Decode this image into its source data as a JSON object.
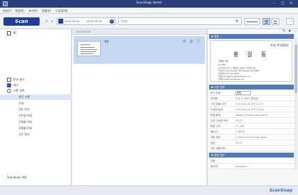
{
  "window": {
    "title": "ScanSnap Home",
    "minimize": "–",
    "maximize": "□",
    "close": "✕"
  },
  "menu": [
    "파일(F)",
    "편집(E)",
    "표시(V)",
    "정렬(S)",
    "도움말(H)"
  ],
  "toolbar": {
    "scan_label": "Scan",
    "date_from": "2019-05-08",
    "date_sep": "-",
    "date_to": "2019-05-18",
    "keyword_placeholder": "키워드"
  },
  "sidebar": {
    "pc": "PC",
    "items": [
      "문서 정리",
      "태그",
      "스캔 기록"
    ],
    "history": [
      "최근 스캔",
      "오늘",
      "3일 이내",
      "1주일 이내",
      "1개월 이내",
      "3개월 이내",
      "1년 이내"
    ],
    "bottom": "ScanSnap 계정"
  },
  "content": {
    "count_text": "2019-05-18",
    "card_filename": "명함"
  },
  "details": {
    "preview_header": "▼ 명함",
    "bizcard": {
      "company": "우성 주식회사",
      "name": "홍 길 동",
      "job": "기획부 차장",
      "lines": [
        "135-081",
        "서울특별시 강남구 테헤란로 100-1 우성빌딩 3층",
        "전화번호 (02) 123-4567  팩스번호 (02) 123-4568",
        "휴대전화 010-1234-5678",
        "이메일 honggildong@wooseong.co.kr",
        "홈페이지 www.wooseong.co.kr"
      ]
    },
    "basic_header": "▼ 기본 정보",
    "basic": [
      {
        "k": "문서 유형",
        "v": "명함"
      },
      {
        "k": "타이틀",
        "v": "우성 주식회사_홍길동"
      },
      {
        "k": "스캔 날짜/시간",
        "v": "2019-05-18 오전 11:27"
      },
      {
        "k": "수정한 날짜",
        "v": "2019-05-18 오전 11:28"
      },
      {
        "k": "파일 종류",
        "v": "Adobe Acrobat Document"
      },
      {
        "k": "검색 가능한 PDF",
        "v": "아니오"
      },
      {
        "k": "파일 크기",
        "v": "1.1 MB"
      },
      {
        "k": "페이지",
        "v": "2 페이지"
      },
      {
        "k": "저장 위치",
        "v": "C:\\Users\\ScanSnap Home"
      },
      {
        "k": "잠금",
        "v": "아니오"
      },
      {
        "k": "관련 애플리케...",
        "v": ""
      }
    ],
    "card_header": "▼ 명함 정보",
    "card_info": [
      {
        "k": "이름",
        "v": ""
      },
      {
        "k": "회사명",
        "v": "wooseon"
      }
    ]
  },
  "status": {
    "brand": "ScanSnap"
  }
}
